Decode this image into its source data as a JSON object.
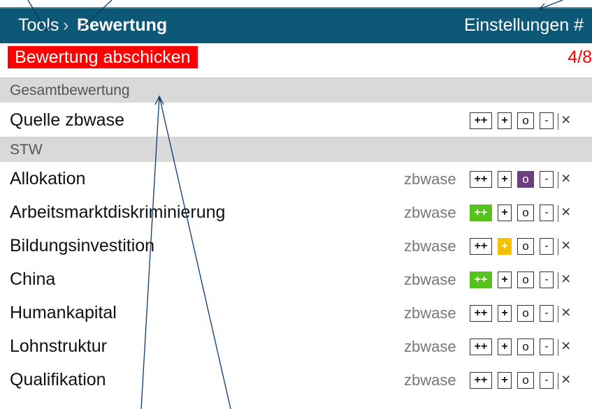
{
  "header": {
    "breadcrumb_root": "Tools",
    "breadcrumb_sep": "›",
    "breadcrumb_current": "Bewertung",
    "settings_label": "Einstellungen #"
  },
  "submit": {
    "label": "Bewertung abschicken",
    "counter": "4/8"
  },
  "sections": {
    "overall": "Gesamtbewertung",
    "stw": "STW"
  },
  "rating_labels": {
    "pp": "++",
    "p": "+",
    "o": "o",
    "m": "-",
    "x": "×"
  },
  "overall_row": {
    "label": "Quelle zbwase"
  },
  "rows": [
    {
      "label": "Allokation",
      "source": "zbwase",
      "selected": "o"
    },
    {
      "label": "Arbeitsmarktdiskriminierung",
      "source": "zbwase",
      "selected": "pp"
    },
    {
      "label": "Bildungsinvestition",
      "source": "zbwase",
      "selected": "p"
    },
    {
      "label": "China",
      "source": "zbwase",
      "selected": "pp"
    },
    {
      "label": "Humankapital",
      "source": "zbwase",
      "selected": ""
    },
    {
      "label": "Lohnstruktur",
      "source": "zbwase",
      "selected": ""
    },
    {
      "label": "Qualifikation",
      "source": "zbwase",
      "selected": ""
    }
  ],
  "colors": {
    "header_bg": "#0d5877",
    "submit_bg": "#ff0000",
    "pp_selected": "#57c11e",
    "p_selected": "#f3c100",
    "o_selected": "#6d3f7e"
  }
}
